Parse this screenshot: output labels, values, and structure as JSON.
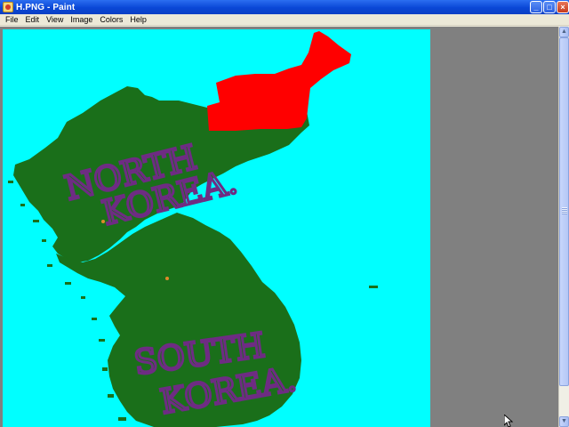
{
  "window": {
    "title": "H.PNG - Paint",
    "buttons": {
      "minimize": "_",
      "maximize": "□",
      "close": "×"
    }
  },
  "menu": {
    "items": [
      {
        "id": "file",
        "label": "File"
      },
      {
        "id": "edit",
        "label": "Edit"
      },
      {
        "id": "view",
        "label": "View"
      },
      {
        "id": "image",
        "label": "Image"
      },
      {
        "id": "colors",
        "label": "Colors"
      },
      {
        "id": "help",
        "label": "Help"
      }
    ]
  },
  "canvas": {
    "colors": {
      "sea": "#00ffff",
      "land": "#1a6f1a",
      "highlight": "#ff0000",
      "text": "#6e2c83",
      "marker": "#e08a2a",
      "workspace": "#808080"
    },
    "labels": {
      "north_line1": "NORTH",
      "north_line2": "KOREA.",
      "south_line1": "SOUTH",
      "south_line2": "KOREA."
    }
  },
  "scrollbar": {
    "up_icon": "▲",
    "down_icon": "▼"
  }
}
